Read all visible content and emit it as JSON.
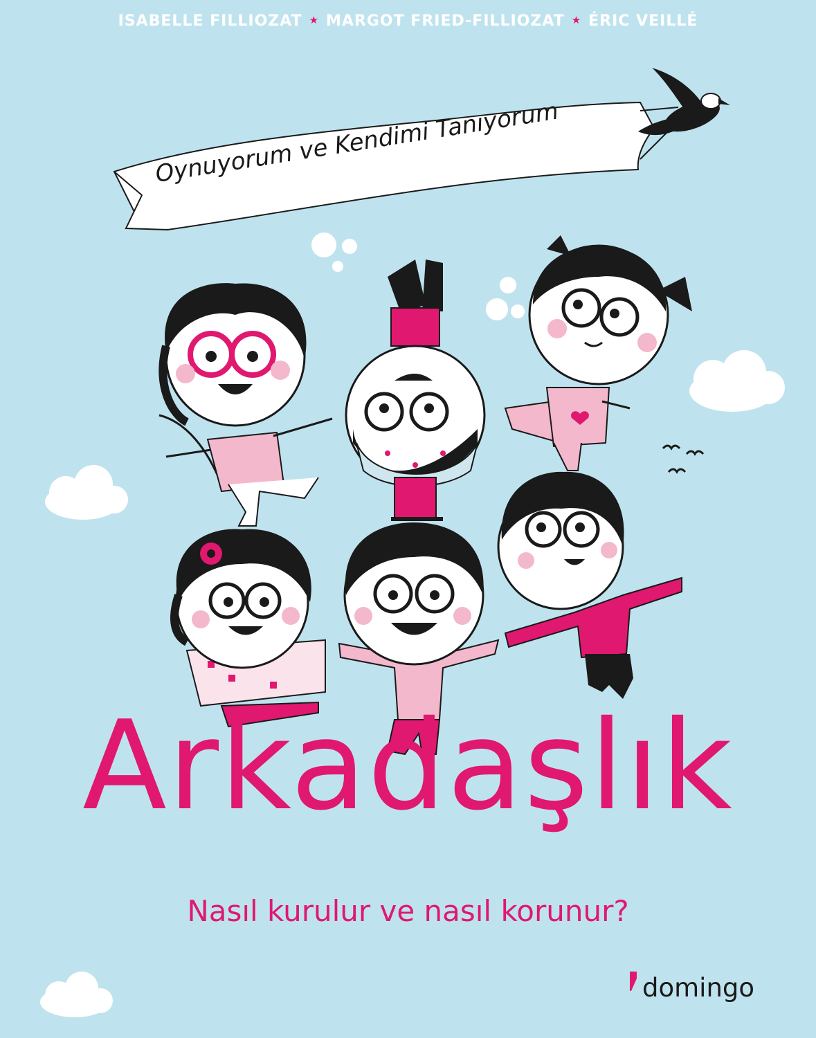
{
  "cover": {
    "authors": [
      "ISABELLE FILLIOZAT",
      "MARGOT FRIED-FILLIOZAT",
      "ÉRIC VEILLÉ"
    ],
    "series_banner": "Oynuyorum ve Kendimi Tanıyorum",
    "title": "Arkadaşlık",
    "subtitle": "Nasıl kurulur ve nasıl korunur?",
    "publisher": "domingo"
  },
  "colors": {
    "background": "#bfe3ee",
    "accent_pink": "#e0186f",
    "light_pink": "#f3b8cc",
    "ink": "#1a1a1a",
    "white": "#ffffff"
  },
  "icons": [
    "star-separator",
    "bird-icon",
    "cloud-icon",
    "heart-icon",
    "flower-icon",
    "publisher-logo-mark"
  ]
}
